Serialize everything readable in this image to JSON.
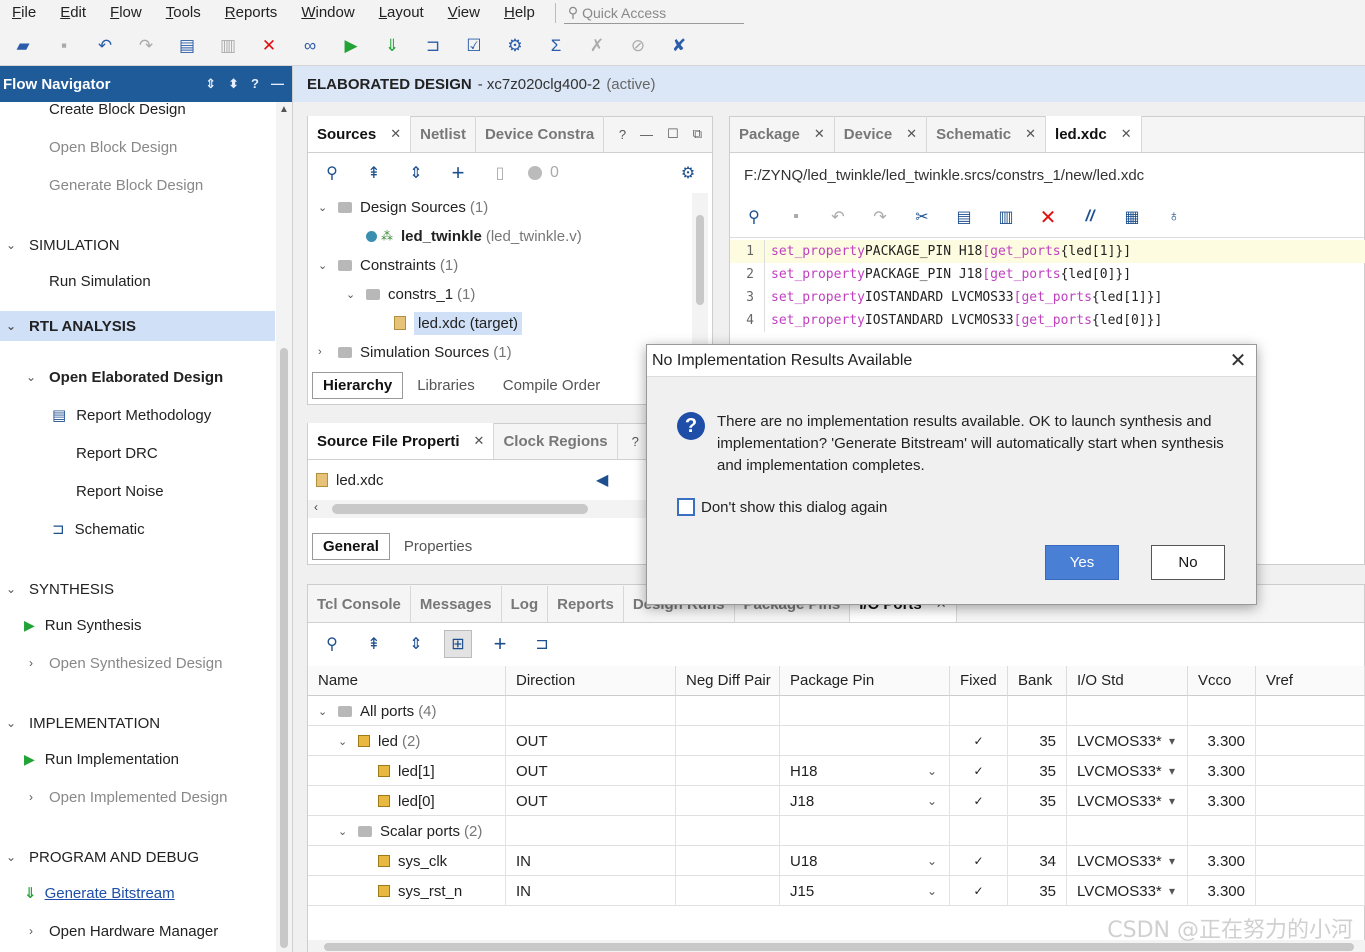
{
  "menu": {
    "items": [
      {
        "label": "File",
        "u": "F",
        "rest": "ile"
      },
      {
        "label": "Edit",
        "u": "E",
        "rest": "dit"
      },
      {
        "label": "Flow",
        "u": "F",
        "rest": "low"
      },
      {
        "label": "Tools",
        "u": "T",
        "rest": "ools"
      },
      {
        "label": "Reports",
        "u": "R",
        "rest": "eports"
      },
      {
        "label": "Window",
        "u": "W",
        "rest": "indow"
      },
      {
        "label": "Layout",
        "u": "L",
        "rest": "ayout"
      },
      {
        "label": "View",
        "u": "V",
        "rest": "iew"
      },
      {
        "label": "Help",
        "u": "H",
        "rest": "elp"
      }
    ],
    "quick_access_placeholder": "Quick Access"
  },
  "flow_navigator": {
    "title": "Flow Navigator",
    "items": [
      {
        "label": "Create Block Design",
        "kind": "item",
        "state": "normal"
      },
      {
        "label": "Open Block Design",
        "kind": "item",
        "state": "disabled"
      },
      {
        "label": "Generate Block Design",
        "kind": "item",
        "state": "disabled"
      },
      {
        "label": "SIMULATION",
        "kind": "section"
      },
      {
        "label": "Run Simulation",
        "kind": "item",
        "state": "normal"
      },
      {
        "label": "RTL ANALYSIS",
        "kind": "section",
        "state": "selected"
      },
      {
        "label": "Open Elaborated Design",
        "kind": "sub",
        "state": "bold"
      },
      {
        "label": "Report Methodology",
        "kind": "sub2",
        "state": "normal"
      },
      {
        "label": "Report DRC",
        "kind": "sub2",
        "state": "normal"
      },
      {
        "label": "Report Noise",
        "kind": "sub2",
        "state": "normal"
      },
      {
        "label": "Schematic",
        "kind": "sub2",
        "state": "normal"
      },
      {
        "label": "SYNTHESIS",
        "kind": "section"
      },
      {
        "label": "Run Synthesis",
        "kind": "item",
        "state": "normal"
      },
      {
        "label": "Open Synthesized Design",
        "kind": "sub",
        "state": "disabled"
      },
      {
        "label": "IMPLEMENTATION",
        "kind": "section"
      },
      {
        "label": "Run Implementation",
        "kind": "item",
        "state": "normal"
      },
      {
        "label": "Open Implemented Design",
        "kind": "sub",
        "state": "disabled"
      },
      {
        "label": "PROGRAM AND DEBUG",
        "kind": "section"
      },
      {
        "label": "Generate Bitstream",
        "kind": "item",
        "state": "link"
      },
      {
        "label": "Open Hardware Manager",
        "kind": "sub",
        "state": "normal"
      }
    ]
  },
  "header_band": {
    "title": "ELABORATED DESIGN",
    "part": "- xc7z020clg400-2",
    "status": "(active)"
  },
  "sources_panel": {
    "tabs": [
      "Sources",
      "Netlist",
      "Device Constra"
    ],
    "count_badge": "0",
    "tree": {
      "design_sources": "Design Sources",
      "design_sources_count": "(1)",
      "top_module": "led_twinkle",
      "top_module_file": "(led_twinkle.v)",
      "constraints": "Constraints",
      "constraints_count": "(1)",
      "constrs": "constrs_1",
      "constrs_count": "(1)",
      "xdc": "led.xdc (target)",
      "sim_sources": "Simulation Sources",
      "sim_sources_count": "(1)"
    },
    "bottom_tabs": [
      "Hierarchy",
      "Libraries",
      "Compile Order"
    ]
  },
  "props_panel": {
    "tabs": [
      "Source File Properti",
      "Clock Regions"
    ],
    "file": "led.xdc",
    "bottom_tabs": [
      "General",
      "Properties"
    ]
  },
  "editor": {
    "tabs": [
      "Package",
      "Device",
      "Schematic",
      "led.xdc"
    ],
    "path": "F:/ZYNQ/led_twinkle/led_twinkle.srcs/constrs_1/new/led.xdc",
    "lines": [
      {
        "n": "1",
        "cmd": "set_property",
        "prop": " PACKAGE_PIN H18 ",
        "gp": "[get_ports",
        "arg": " {led[1]}]"
      },
      {
        "n": "2",
        "cmd": "set_property",
        "prop": " PACKAGE_PIN J18 ",
        "gp": "[get_ports",
        "arg": " {led[0]}]"
      },
      {
        "n": "3",
        "cmd": "set_property",
        "prop": " IOSTANDARD LVCMOS33 ",
        "gp": "[get_ports",
        "arg": " {led[1]}]"
      },
      {
        "n": "4",
        "cmd": "set_property",
        "prop": " IOSTANDARD LVCMOS33 ",
        "gp": "[get_ports",
        "arg": " {led[0]}]"
      }
    ]
  },
  "dialog": {
    "title": "No Implementation Results Available",
    "message": "There are no implementation results available. OK to launch synthesis and implementation? 'Generate Bitstream' will automatically start when synthesis and implementation completes.",
    "checkbox": "Don't show this dialog again",
    "yes": "Yes",
    "no": "No"
  },
  "bottom_panel": {
    "tabs": [
      "Tcl Console",
      "Messages",
      "Log",
      "Reports",
      "Design Runs",
      "Package Pins",
      "I/O Ports"
    ],
    "columns": [
      "Name",
      "Direction",
      "Neg Diff Pair",
      "Package Pin",
      "Fixed",
      "Bank",
      "I/O Std",
      "Vcco",
      "Vref"
    ],
    "rows": [
      {
        "name": "All ports",
        "count": "(4)",
        "level": 0,
        "dir": "",
        "pin": "",
        "fixed": "",
        "bank": "",
        "iostd": "",
        "vcco": ""
      },
      {
        "name": "led",
        "count": "(2)",
        "level": 1,
        "dir": "OUT",
        "pin": "",
        "fixed": "✓",
        "bank": "35",
        "iostd": "LVCMOS33*",
        "vcco": "3.300"
      },
      {
        "name": "led[1]",
        "count": "",
        "level": 2,
        "dir": "OUT",
        "pin": "H18",
        "fixed": "✓",
        "bank": "35",
        "iostd": "LVCMOS33*",
        "vcco": "3.300"
      },
      {
        "name": "led[0]",
        "count": "",
        "level": 2,
        "dir": "OUT",
        "pin": "J18",
        "fixed": "✓",
        "bank": "35",
        "iostd": "LVCMOS33*",
        "vcco": "3.300"
      },
      {
        "name": "Scalar ports",
        "count": "(2)",
        "level": 1,
        "dir": "",
        "pin": "",
        "fixed": "",
        "bank": "",
        "iostd": "",
        "vcco": ""
      },
      {
        "name": "sys_clk",
        "count": "",
        "level": 2,
        "dir": "IN",
        "pin": "U18",
        "fixed": "✓",
        "bank": "34",
        "iostd": "LVCMOS33*",
        "vcco": "3.300"
      },
      {
        "name": "sys_rst_n",
        "count": "",
        "level": 2,
        "dir": "IN",
        "pin": "J15",
        "fixed": "✓",
        "bank": "35",
        "iostd": "LVCMOS33*",
        "vcco": "3.300"
      }
    ]
  },
  "watermark": "CSDN @正在努力的小河"
}
